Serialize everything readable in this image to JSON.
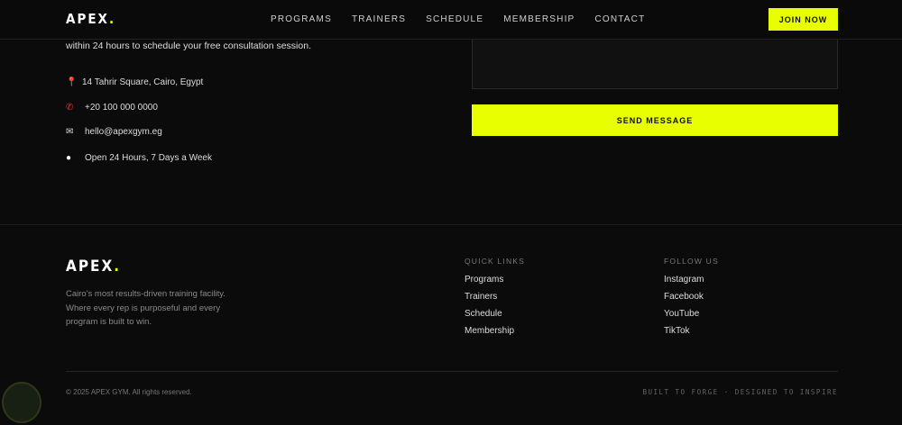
{
  "nav": {
    "logo": "APEX",
    "logo_dot": ".",
    "links": [
      "PROGRAMS",
      "TRAINERS",
      "SCHEDULE",
      "MEMBERSHIP",
      "CONTACT"
    ],
    "cta": "JOIN NOW"
  },
  "contact": {
    "intro": "within 24 hours to schedule your free consultation session.",
    "items": [
      {
        "icon": "map-pin-icon",
        "text": "14 Tahrir Square, Cairo, Egypt"
      },
      {
        "icon": "phone-icon",
        "text": "+20 100 000 0000"
      },
      {
        "icon": "mail-icon",
        "text": "hello@apexgym.eg"
      },
      {
        "icon": "clock-icon",
        "text": "Open 24 Hours, 7 Days a Week"
      }
    ],
    "send": "SEND MESSAGE"
  },
  "footer": {
    "logo": "APEX",
    "logo_dot": ".",
    "tagline": "Cairo's most results-driven training facility. Where every rep is purposeful and every program is built to win.",
    "quick_links": {
      "title": "QUICK LINKS",
      "items": [
        "Programs",
        "Trainers",
        "Schedule",
        "Membership"
      ]
    },
    "follow": {
      "title": "FOLLOW US",
      "items": [
        "Instagram",
        "Facebook",
        "YouTube",
        "TikTok"
      ]
    },
    "copyright": "© 2025 APEX GYM. All rights reserved.",
    "motto": "BUILT TO FORGE · DESIGNED TO INSPIRE"
  },
  "colors": {
    "accent": "#e8ff00",
    "background": "#0b0b0b",
    "icon_red": "#e0342b"
  }
}
